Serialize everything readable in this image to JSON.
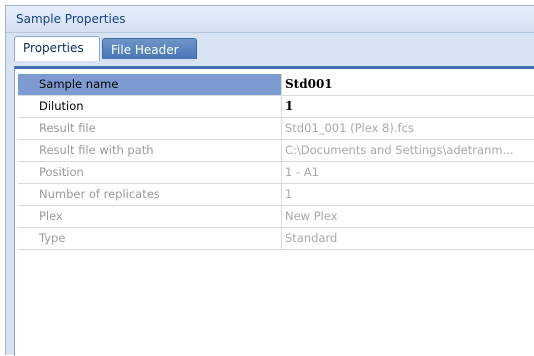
{
  "window": {
    "title": "Sample Properties"
  },
  "tabs": [
    {
      "label": "Properties",
      "selected": false
    },
    {
      "label": "File Header",
      "selected": true
    }
  ],
  "properties": [
    {
      "name": "Sample name",
      "value": "Std001",
      "editable": true,
      "selected": true
    },
    {
      "name": "Dilution",
      "value": "1",
      "editable": true,
      "selected": false
    },
    {
      "name": "Result file",
      "value": "Std01_001 (Plex 8).fcs",
      "editable": false
    },
    {
      "name": "Result file with path",
      "value": "C:\\Documents and Settings\\adetranm...",
      "editable": false
    },
    {
      "name": "Position",
      "value": "1 - A1",
      "editable": false
    },
    {
      "name": "Number of replicates",
      "value": "1",
      "editable": false
    },
    {
      "name": "Plex",
      "value": "New Plex",
      "editable": false
    },
    {
      "name": "Type",
      "value": "Standard",
      "editable": false
    }
  ],
  "colors": {
    "accent": "#4470b1",
    "selection": "#7d9bd1",
    "title_text": "#15428b"
  }
}
